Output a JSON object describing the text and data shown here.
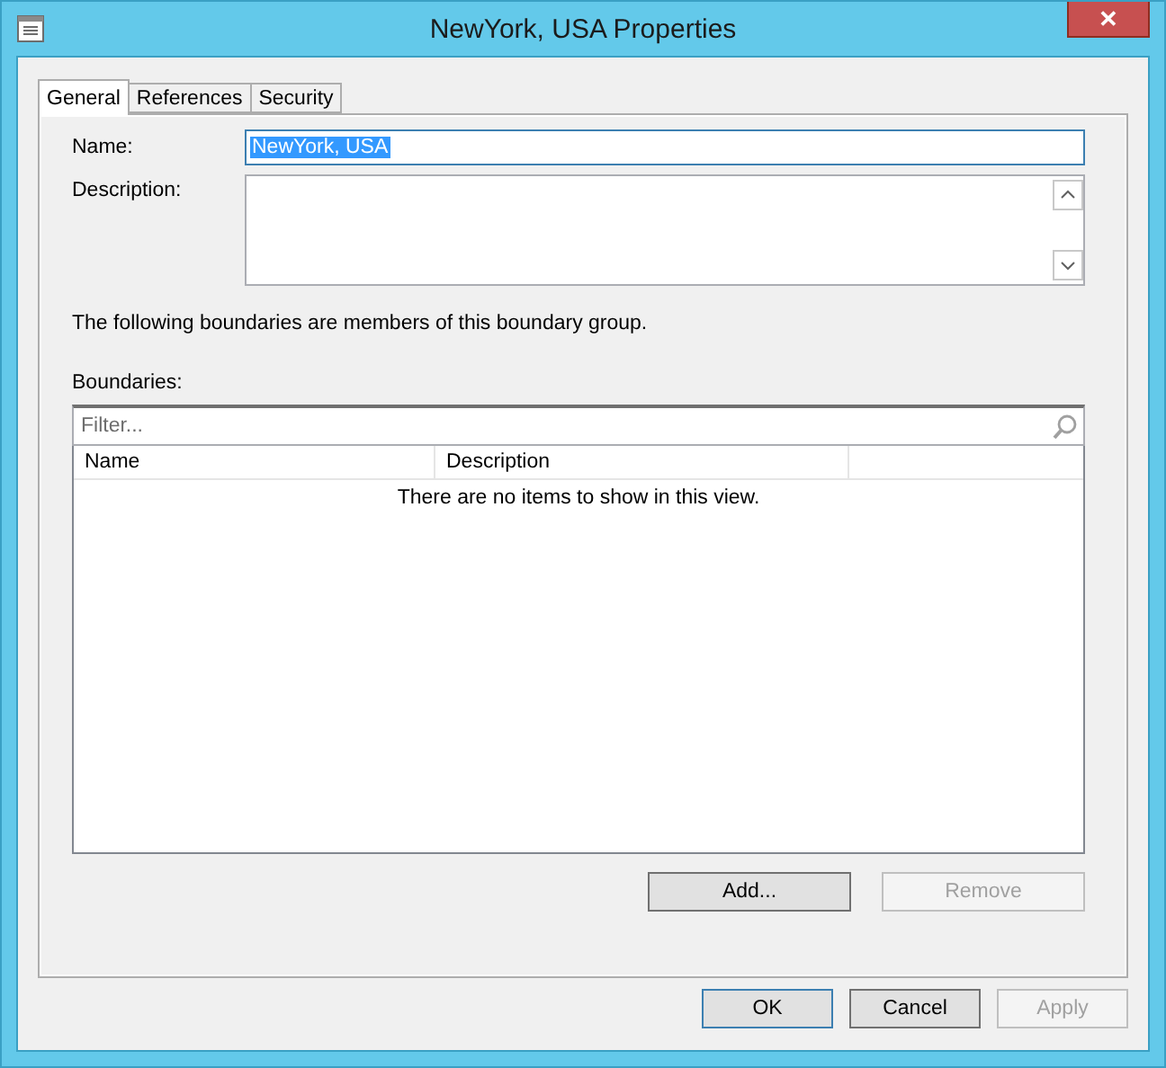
{
  "window": {
    "title": "NewYork, USA Properties",
    "close": "✕"
  },
  "tabs": [
    {
      "label": "General",
      "selected": true
    },
    {
      "label": "References",
      "selected": false
    },
    {
      "label": "Security",
      "selected": false
    }
  ],
  "general": {
    "name_label": "Name:",
    "name_value": "NewYork, USA",
    "name_value_selected": true,
    "description_label": "Description:",
    "members_text": "The following boundaries are members of this boundary group.",
    "boundaries_label": "Boundaries:",
    "filter": {
      "placeholder": "Filter..."
    },
    "table": {
      "columns": [
        "Name",
        "Description"
      ],
      "empty_text": "There are no items to show in this view."
    },
    "buttons": [
      {
        "label": "Add...",
        "disabled": false
      },
      {
        "label": "Remove",
        "disabled": true
      }
    ]
  },
  "footer_buttons": [
    {
      "label": "OK",
      "disabled": false,
      "default": true
    },
    {
      "label": "Cancel",
      "disabled": false,
      "default": false
    },
    {
      "label": "Apply",
      "disabled": true,
      "default": false
    }
  ]
}
